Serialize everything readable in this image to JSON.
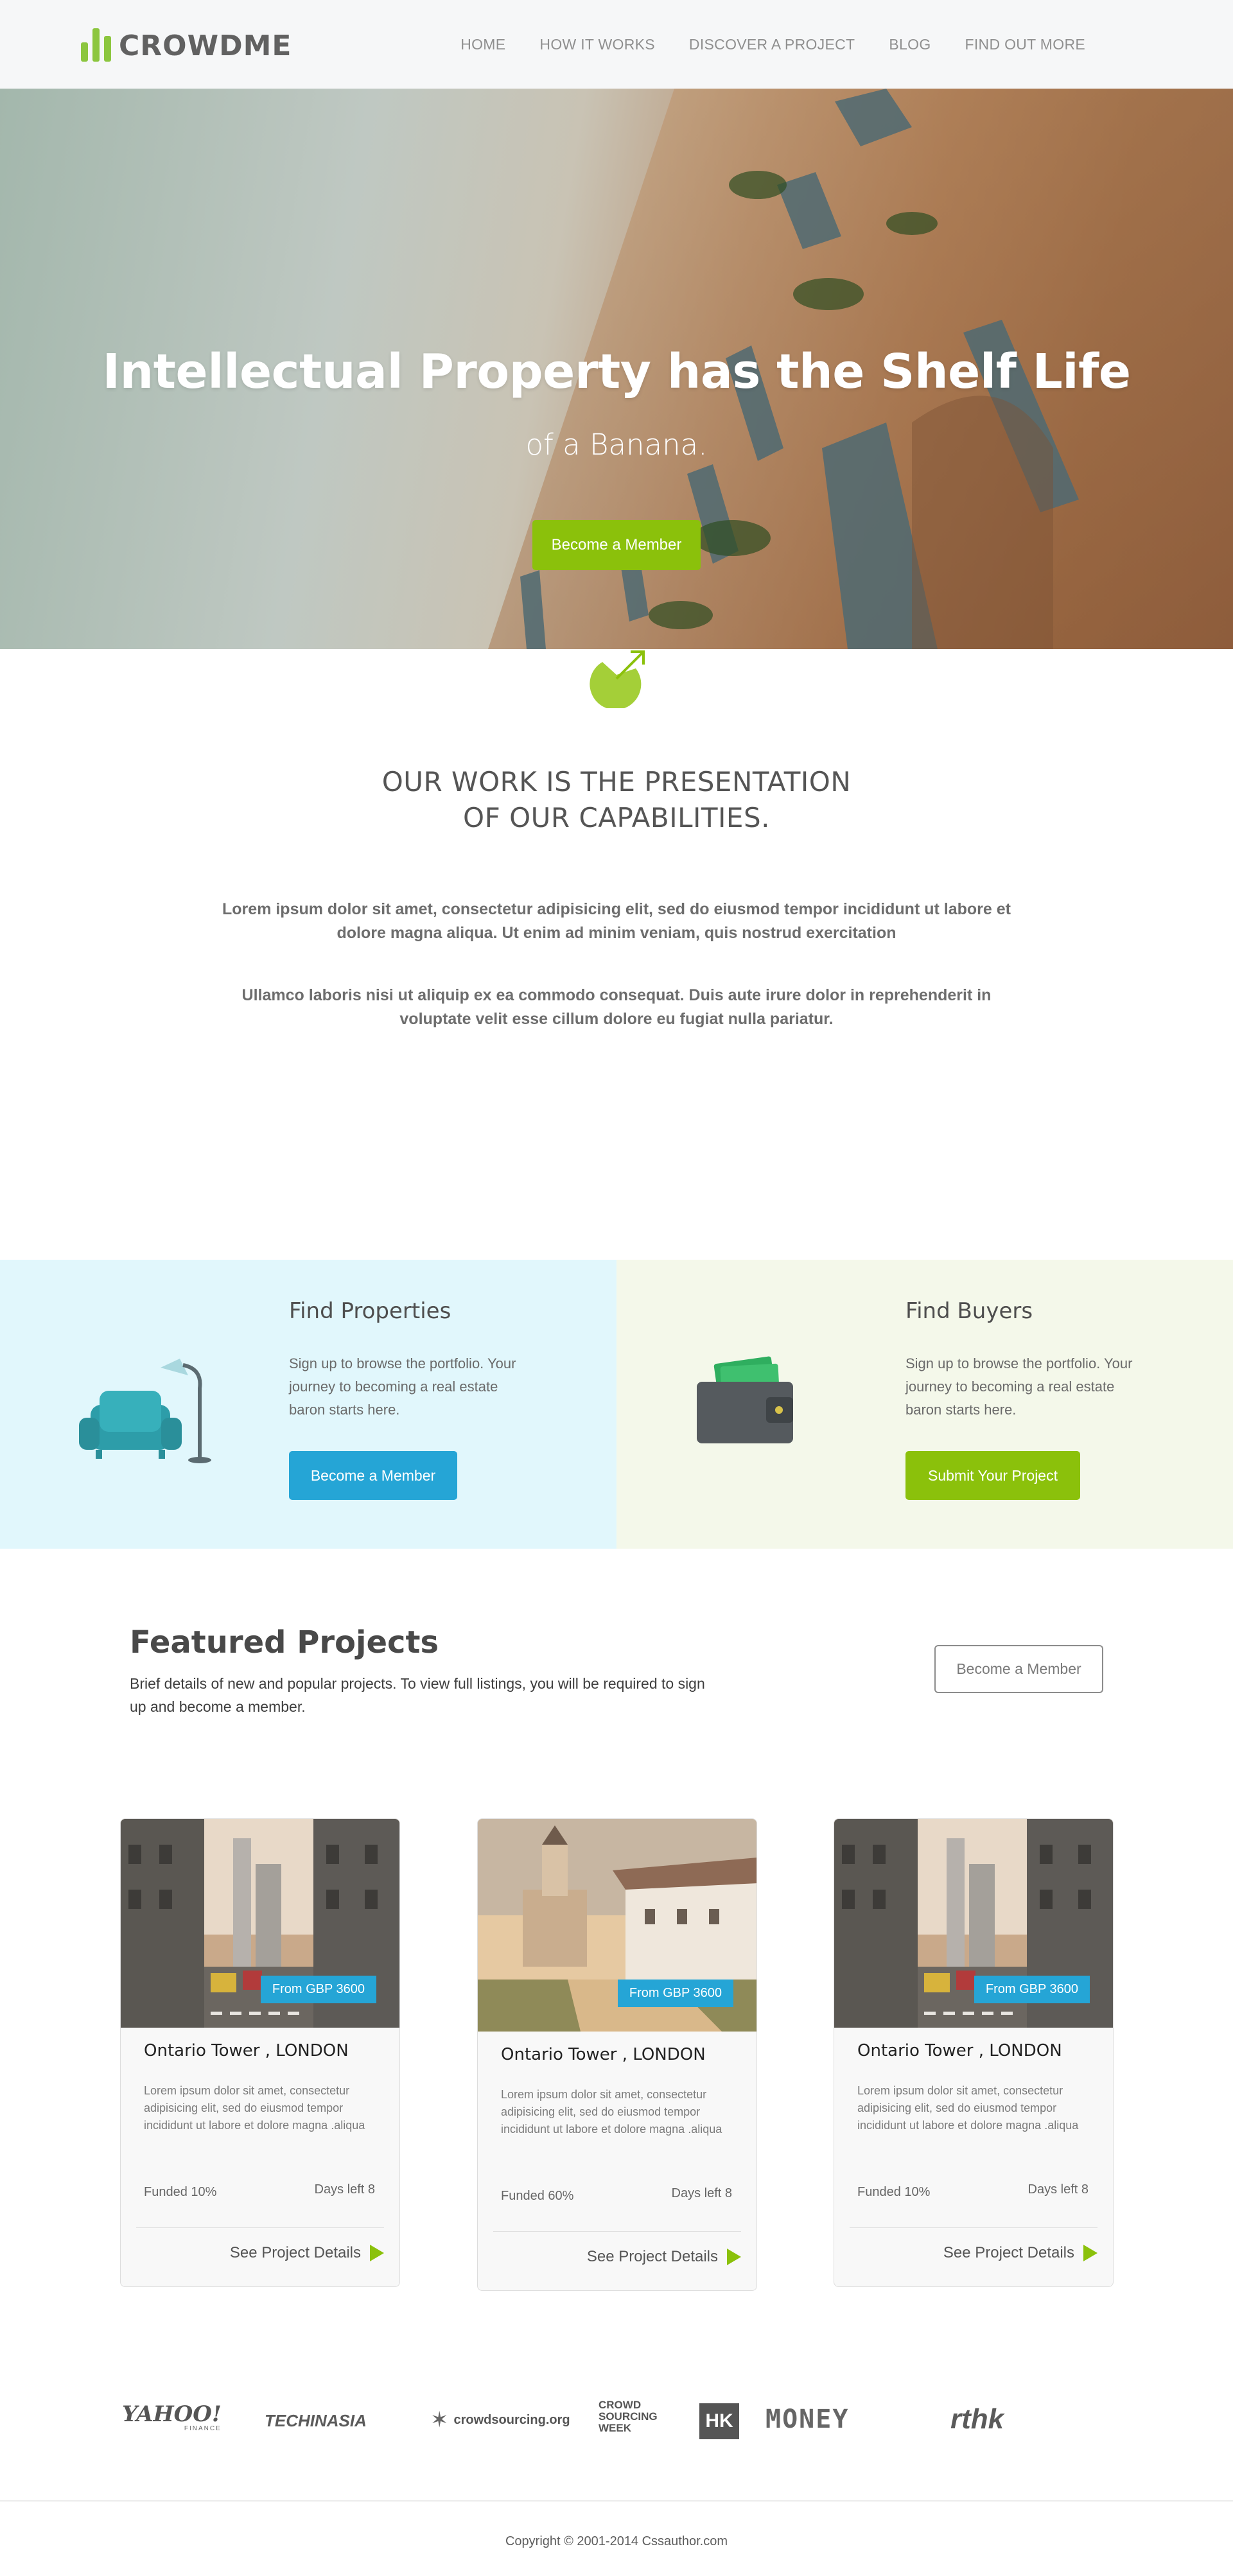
{
  "brand": {
    "name": "CROWDME",
    "accent": "#8bc10b",
    "blue": "#25a5d6"
  },
  "nav": {
    "items": [
      "HOME",
      "HOW IT WORKS",
      "DISCOVER A PROJECT",
      "BLOG",
      "FIND OUT MORE"
    ]
  },
  "hero": {
    "title": "Intellectual Property has the Shelf Life",
    "subtitle": "of a Banana.",
    "button": "Become a Member"
  },
  "intro": {
    "icon": "pie-chart-arrow-icon",
    "title_line1": "OUR WORK IS THE PRESENTATION",
    "title_line2": "OF OUR CAPABILITIES.",
    "paragraph1": "Lorem ipsum dolor sit amet, consectetur adipisicing elit, sed do eiusmod tempor incididunt ut labore et dolore magna aliqua. Ut enim ad minim veniam, quis nostrud exercitation",
    "paragraph2": "Ullamco laboris nisi ut aliquip ex ea commodo consequat. Duis aute irure dolor in reprehenderit in voluptate velit esse cillum dolore eu fugiat nulla pariatur."
  },
  "properties": {
    "title": "Find Properties",
    "text": "Sign up to browse the portfolio. Your journey to becoming a real estate baron starts here.",
    "button": "Become a Member",
    "icon": "armchair-lamp-icon"
  },
  "buyers": {
    "title": "Find Buyers",
    "text": "Sign up to browse the portfolio. Your journey to becoming a real estate baron starts here.",
    "button": "Submit Your Project",
    "icon": "wallet-icon"
  },
  "featured": {
    "title": "Featured Projects",
    "description": "Brief details of new and popular projects. To view full listings, you will be required to sign up and become a member.",
    "button": "Become a Member",
    "cards": [
      {
        "price": "From GBP 3600",
        "title": "Ontario Tower , LONDON",
        "text": "Lorem ipsum dolor sit amet, consectetur adipisicing elit, sed do eiusmod tempor incididunt ut labore et dolore magna .aliqua",
        "funded": "Funded 10%",
        "days": "Days left 8",
        "link": "See Project Details"
      },
      {
        "price": "From GBP 3600",
        "title": "Ontario Tower , LONDON",
        "text": "Lorem ipsum dolor sit amet, consectetur adipisicing elit, sed do eiusmod tempor incididunt ut labore et dolore magna .aliqua",
        "funded": "Funded 60%",
        "days": "Days left 8",
        "link": "See Project Details"
      },
      {
        "price": "From GBP 3600",
        "title": "Ontario Tower , LONDON",
        "text": "Lorem ipsum dolor sit amet, consectetur adipisicing elit, sed do eiusmod tempor incididunt ut labore et dolore magna .aliqua",
        "funded": "Funded 10%",
        "days": "Days left 8",
        "link": "See Project Details"
      }
    ]
  },
  "partners": [
    {
      "name": "YAHOO!",
      "sub": "FINANCE"
    },
    {
      "name": "TECHINASIA"
    },
    {
      "name": "crowdsourcing.org"
    },
    {
      "name": "CROWD SOURCING WEEK"
    },
    {
      "name": "HK"
    },
    {
      "name": "MONEY"
    },
    {
      "name": "rthk"
    }
  ],
  "footer": {
    "copyright": "Copyright © 2001-2014 Cssauthor.com"
  }
}
